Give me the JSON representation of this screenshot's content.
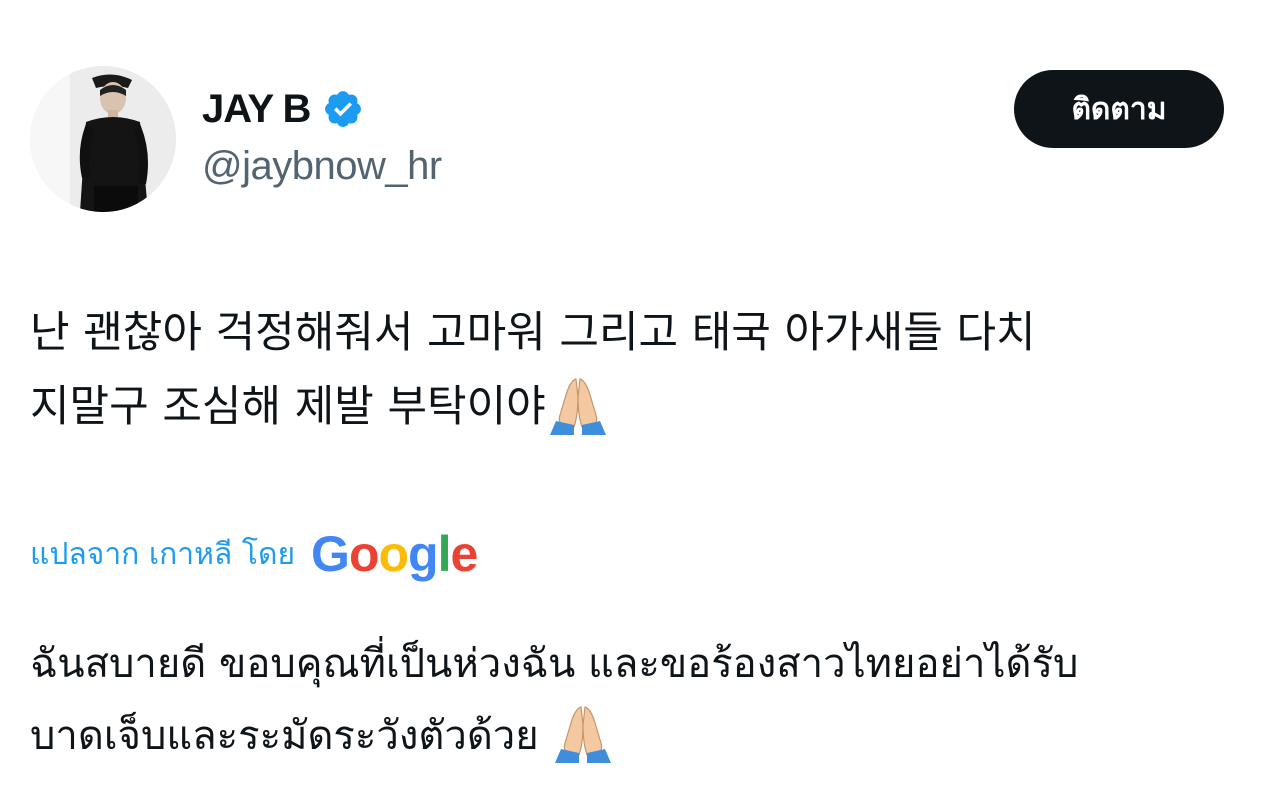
{
  "user": {
    "display_name": "JAY B",
    "handle": "@jaybnow_hr",
    "verified": true,
    "avatar_icon": "profile-photo"
  },
  "follow_button": {
    "label": "ติดตาม"
  },
  "tweet": {
    "lines": [
      "난 괜찮아 걱정해줘서 고마워 그리고 태국 아가새들 다치",
      "지말구 조심해 제발 부탁이야"
    ],
    "emoji": "🙏"
  },
  "translation": {
    "label": "แปลจาก เกาหลี โดย",
    "provider_letters": [
      "G",
      "o",
      "o",
      "g",
      "l",
      "e"
    ],
    "lines": [
      "ฉันสบายดี ขอบคุณที่เป็นห่วงฉัน และขอร้องสาวไทยอย่าได้รับ",
      "บาดเจ็บและระมัดระวังตัวด้วย"
    ],
    "emoji": "🙏"
  },
  "colors": {
    "text_primary": "#0f1419",
    "text_secondary": "#536471",
    "link_blue": "#1d9bf0",
    "verified_blue": "#1d9bf0",
    "button_bg": "#0f1419",
    "google_blue": "#4285f4",
    "google_red": "#ea4335",
    "google_yellow": "#fbbc05",
    "google_green": "#34a853"
  }
}
